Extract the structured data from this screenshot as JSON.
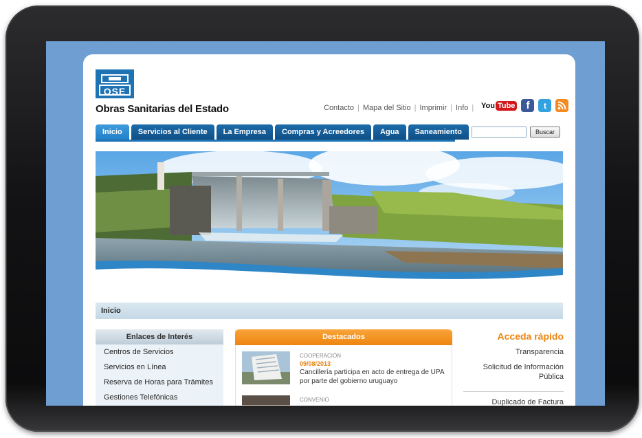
{
  "site": {
    "logo_text": "OSE",
    "title": "Obras Sanitarias del Estado"
  },
  "top_links": [
    "Contacto",
    "Mapa del Sitio",
    "Imprimir",
    "Info"
  ],
  "social": {
    "youtube_you": "You",
    "youtube_tube": "Tube",
    "facebook_glyph": "f",
    "twitter_glyph": "t",
    "icons": [
      "youtube-icon",
      "facebook-icon",
      "twitter-icon",
      "rss-icon"
    ]
  },
  "nav": {
    "tabs": [
      "Inicio",
      "Servicios al Cliente",
      "La Empresa",
      "Compras y Acreedores",
      "Agua",
      "Saneamiento"
    ],
    "active": "Inicio"
  },
  "search": {
    "value": "",
    "button_label": "Buscar"
  },
  "breadcrumb": "Inicio",
  "enlaces": {
    "heading": "Enlaces de Interés",
    "items": [
      "Centros de Servicios",
      "Servicios en Línea",
      "Reserva de Horas para Trámites",
      "Gestiones Telefónicas"
    ]
  },
  "destacados": {
    "heading": "Destacados",
    "items": [
      {
        "category": "COOPERACIÓN",
        "date": "09/08/2013",
        "title": "Cancillería participa en acto de entrega de UPA por parte del gobierno uruguayo"
      },
      {
        "category": "CONVENIO",
        "date": "",
        "title": ""
      }
    ]
  },
  "acceda": {
    "heading": "Acceda rápido",
    "links": [
      "Transparencia",
      "Solicitud de Información Pública"
    ],
    "links_after": [
      "Duplicado de Factura"
    ]
  },
  "colors": {
    "brand_blue": "#1e73b5",
    "accent_orange": "#ee8410",
    "screen_bg": "#6f9ed3"
  }
}
